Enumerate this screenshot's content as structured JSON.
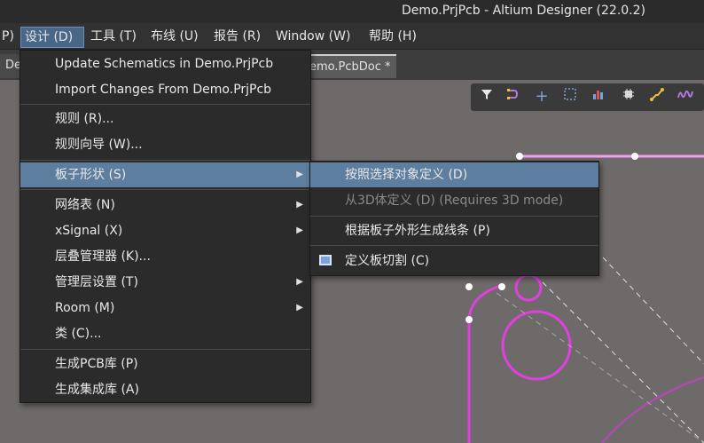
{
  "window": {
    "title": "Demo.PrjPcb - Altium Designer (22.0.2)"
  },
  "menubar": {
    "items": [
      {
        "label": "P)"
      },
      {
        "label": "设计 (D)"
      },
      {
        "label": "工具 (T)"
      },
      {
        "label": "布线 (U)"
      },
      {
        "label": "报告 (R)"
      },
      {
        "label": "Window (W)"
      },
      {
        "label": "帮助 (H)"
      }
    ]
  },
  "tabs": [
    {
      "label": "De"
    },
    {
      "label": "emo.PcbDoc *"
    }
  ],
  "design_menu": {
    "items": [
      {
        "label": "Update Schematics in Demo.PrjPcb"
      },
      {
        "label": "Import Changes From Demo.PrjPcb"
      },
      {
        "label": "规则 (R)..."
      },
      {
        "label": "规则向导 (W)..."
      },
      {
        "label": "板子形状 (S)"
      },
      {
        "label": "网络表 (N)"
      },
      {
        "label": "xSignal (X)"
      },
      {
        "label": "层叠管理器 (K)..."
      },
      {
        "label": "管理层设置 (T)"
      },
      {
        "label": "Room (M)"
      },
      {
        "label": "类 (C)..."
      },
      {
        "label": "生成PCB库 (P)"
      },
      {
        "label": "生成集成库 (A)"
      }
    ]
  },
  "board_shape_submenu": {
    "items": [
      {
        "label": "按照选择对象定义 (D)"
      },
      {
        "label": "从3D体定义 (D) (Requires 3D mode)"
      },
      {
        "label": "根据板子外形生成线条 (P)"
      },
      {
        "label": "定义板切割 (C)"
      }
    ]
  },
  "colors": {
    "board_outline": "#e040e0",
    "canvas": "#6e6a69",
    "highlight": "#5d7e9f",
    "menu_bg": "#2b2b2b"
  },
  "toolbar_icons": [
    "filter-icon",
    "route-icon",
    "cross-icon",
    "select-rect-icon",
    "chart-icon",
    "component-icon",
    "track-icon",
    "wave-icon"
  ]
}
